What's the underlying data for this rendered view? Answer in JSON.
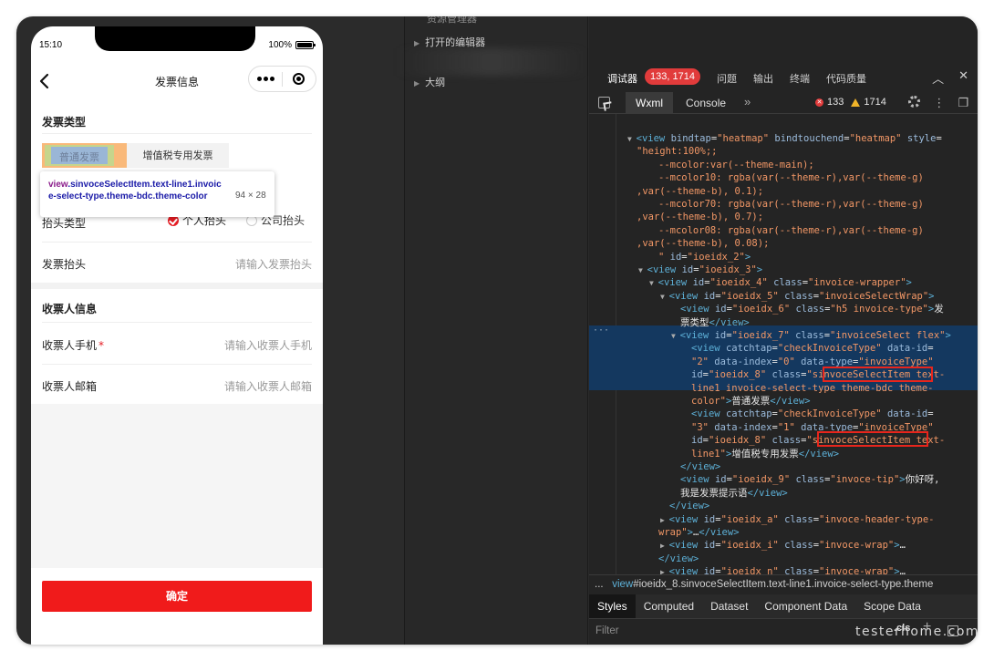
{
  "phone": {
    "status_time": "15:10",
    "battery": "100%",
    "nav_title": "发票信息",
    "section_invoice_type": "发票类型",
    "type_general": "普通发票",
    "type_vat": "增值税专用发票",
    "inspector": {
      "tag": "view",
      "selector_rest": ".sinvoceSelectItem.text-line1.invoice-select-type.theme-bdc.theme-color",
      "size": "94 × 28"
    },
    "title_type_label": "抬头类型",
    "radio_personal": "个人抬头",
    "radio_company": "公司抬头",
    "invoice_title_label": "发票抬头",
    "invoice_title_placeholder": "请输入发票抬头",
    "section_recipient": "收票人信息",
    "recipient_phone_label": "收票人手机",
    "recipient_phone_required": "*",
    "recipient_phone_placeholder": "请输入收票人手机",
    "recipient_email_label": "收票人邮箱",
    "recipient_email_placeholder": "请输入收票人邮箱",
    "confirm": "确定"
  },
  "middle": {
    "top_item": "资源管理器",
    "open_editors": "打开的编辑器",
    "outline": "大纲"
  },
  "devtools": {
    "tab_debugger": "调试器",
    "badge": "133, 1714",
    "tabs_other": [
      "问题",
      "输出",
      "终端",
      "代码质量"
    ],
    "tab_wxml": "Wxml",
    "tab_console": "Console",
    "more": "»",
    "error_count": "133",
    "warn_count": "1714",
    "code_lines": [
      {
        "indent": 0,
        "tri": "▼",
        "parts": [
          [
            "tg",
            "<view "
          ],
          [
            "at",
            "bindtap"
          ],
          [
            "tx",
            "="
          ],
          [
            "av",
            "\"heatmap\""
          ],
          [
            "at",
            " bindtouchend"
          ],
          [
            "tx",
            "="
          ],
          [
            "av",
            "\"heatmap\""
          ],
          [
            "at",
            " style"
          ],
          [
            "tx",
            "="
          ]
        ]
      },
      {
        "indent": 0,
        "parts": [
          [
            "av",
            "\"height:100%;;"
          ]
        ]
      },
      {
        "indent": 2,
        "parts": [
          [
            "av",
            "--mcolor:var(--theme-main);"
          ]
        ]
      },
      {
        "indent": 2,
        "parts": [
          [
            "av",
            "--mcolor10: rgba(var(--theme-r),var(--theme-g)"
          ]
        ]
      },
      {
        "indent": 0,
        "parts": [
          [
            "av",
            ",var(--theme-b), 0.1);"
          ]
        ]
      },
      {
        "indent": 2,
        "parts": [
          [
            "av",
            "--mcolor70: rgba(var(--theme-r),var(--theme-g)"
          ]
        ]
      },
      {
        "indent": 0,
        "parts": [
          [
            "av",
            ",var(--theme-b), 0.7);"
          ]
        ]
      },
      {
        "indent": 2,
        "parts": [
          [
            "av",
            "--mcolor08: rgba(var(--theme-r),var(--theme-g)"
          ]
        ]
      },
      {
        "indent": 0,
        "parts": [
          [
            "av",
            ",var(--theme-b), 0.08);"
          ]
        ]
      },
      {
        "indent": 2,
        "parts": [
          [
            "av",
            "\""
          ],
          [
            "at",
            " id"
          ],
          [
            "tx",
            "="
          ],
          [
            "av",
            "\"ioeidx_2\""
          ],
          [
            "tg",
            ">"
          ]
        ]
      },
      {
        "indent": 1,
        "tri": "▼",
        "parts": [
          [
            "tg",
            "<view "
          ],
          [
            "at",
            "id"
          ],
          [
            "tx",
            "="
          ],
          [
            "av",
            "\"ioeidx_3\""
          ],
          [
            "tg",
            ">"
          ]
        ]
      },
      {
        "indent": 2,
        "tri": "▼",
        "parts": [
          [
            "tg",
            "<view "
          ],
          [
            "at",
            "id"
          ],
          [
            "tx",
            "="
          ],
          [
            "av",
            "\"ioeidx_4\""
          ],
          [
            "at",
            " class"
          ],
          [
            "tx",
            "="
          ],
          [
            "av",
            "\"invoice-wrapper\""
          ],
          [
            "tg",
            ">"
          ]
        ]
      },
      {
        "indent": 3,
        "tri": "▼",
        "parts": [
          [
            "tg",
            "<view "
          ],
          [
            "at",
            "id"
          ],
          [
            "tx",
            "="
          ],
          [
            "av",
            "\"ioeidx_5\""
          ],
          [
            "at",
            " class"
          ],
          [
            "tx",
            "="
          ],
          [
            "av",
            "\"invoiceSelectWrap\""
          ],
          [
            "tg",
            ">"
          ]
        ]
      },
      {
        "indent": 4,
        "parts": [
          [
            "tg",
            "<view "
          ],
          [
            "at",
            "id"
          ],
          [
            "tx",
            "="
          ],
          [
            "av",
            "\"ioeidx_6\""
          ],
          [
            "at",
            " class"
          ],
          [
            "tx",
            "="
          ],
          [
            "av",
            "\"h5 invoice-type\""
          ],
          [
            "tg",
            ">"
          ],
          [
            "tx",
            "发"
          ]
        ]
      },
      {
        "indent": 4,
        "parts": [
          [
            "tx",
            "票类型"
          ],
          [
            "tg",
            "</view>"
          ]
        ]
      },
      {
        "indent": 4,
        "tri": "▼",
        "parts": [
          [
            "tg",
            "<view "
          ],
          [
            "at",
            "id"
          ],
          [
            "tx",
            "="
          ],
          [
            "av",
            "\"ioeidx_7\""
          ],
          [
            "at",
            " class"
          ],
          [
            "tx",
            "="
          ],
          [
            "av",
            "\"invoiceSelect flex\""
          ],
          [
            "tg",
            ">"
          ]
        ]
      },
      {
        "indent": 5,
        "parts": [
          [
            "tg",
            "<view "
          ],
          [
            "at",
            "catchtap"
          ],
          [
            "tx",
            "="
          ],
          [
            "av",
            "\"checkInvoiceType\""
          ],
          [
            "at",
            " data-id"
          ],
          [
            "tx",
            "="
          ]
        ]
      },
      {
        "indent": 5,
        "parts": [
          [
            "av",
            "\"2\""
          ],
          [
            "at",
            " data-index"
          ],
          [
            "tx",
            "="
          ],
          [
            "av",
            "\"0\""
          ],
          [
            "at",
            " data-type"
          ],
          [
            "tx",
            "="
          ],
          [
            "av",
            "\"invoiceType\""
          ]
        ]
      },
      {
        "indent": 5,
        "parts": [
          [
            "at",
            "id"
          ],
          [
            "tx",
            "="
          ],
          [
            "av",
            "\"ioeidx_8\""
          ],
          [
            "at",
            " class"
          ],
          [
            "tx",
            "="
          ],
          [
            "av",
            "\"sinvoceSelectItem text-"
          ]
        ]
      },
      {
        "indent": 5,
        "parts": [
          [
            "av",
            "line1 invoice-select-type theme-bdc theme-"
          ]
        ]
      },
      {
        "indent": 5,
        "parts": [
          [
            "av",
            "color\""
          ],
          [
            "tg",
            ">"
          ],
          [
            "tx",
            "普通发票"
          ],
          [
            "tg",
            "</view>"
          ]
        ]
      },
      {
        "indent": 5,
        "parts": [
          [
            "tg",
            "<view "
          ],
          [
            "at",
            "catchtap"
          ],
          [
            "tx",
            "="
          ],
          [
            "av",
            "\"checkInvoiceType\""
          ],
          [
            "at",
            " data-id"
          ],
          [
            "tx",
            "="
          ]
        ]
      },
      {
        "indent": 5,
        "parts": [
          [
            "av",
            "\"3\""
          ],
          [
            "at",
            " data-index"
          ],
          [
            "tx",
            "="
          ],
          [
            "av",
            "\"1\""
          ],
          [
            "at",
            " data-type"
          ],
          [
            "tx",
            "="
          ],
          [
            "av",
            "\"invoiceType\""
          ]
        ]
      },
      {
        "indent": 5,
        "parts": [
          [
            "at",
            "id"
          ],
          [
            "tx",
            "="
          ],
          [
            "av",
            "\"ioeidx_8\""
          ],
          [
            "at",
            " class"
          ],
          [
            "tx",
            "="
          ],
          [
            "av",
            "\"sinvoceSelectItem text-"
          ]
        ]
      },
      {
        "indent": 5,
        "parts": [
          [
            "av",
            "line1\""
          ],
          [
            "tg",
            ">"
          ],
          [
            "tx",
            "增值税专用发票"
          ],
          [
            "tg",
            "</view>"
          ]
        ]
      },
      {
        "indent": 4,
        "parts": [
          [
            "tg",
            "</view>"
          ]
        ]
      },
      {
        "indent": 4,
        "parts": [
          [
            "tg",
            "<view "
          ],
          [
            "at",
            "id"
          ],
          [
            "tx",
            "="
          ],
          [
            "av",
            "\"ioeidx_9\""
          ],
          [
            "at",
            " class"
          ],
          [
            "tx",
            "="
          ],
          [
            "av",
            "\"invoce-tip\""
          ],
          [
            "tg",
            ">"
          ],
          [
            "tx",
            "你好呀,"
          ]
        ]
      },
      {
        "indent": 4,
        "parts": [
          [
            "tx",
            "我是发票提示语"
          ],
          [
            "tg",
            "</view>"
          ]
        ]
      },
      {
        "indent": 3,
        "parts": [
          [
            "tg",
            "</view>"
          ]
        ]
      },
      {
        "indent": 3,
        "tri": "▶",
        "parts": [
          [
            "tg",
            "<view "
          ],
          [
            "at",
            "id"
          ],
          [
            "tx",
            "="
          ],
          [
            "av",
            "\"ioeidx_a\""
          ],
          [
            "at",
            " class"
          ],
          [
            "tx",
            "="
          ],
          [
            "av",
            "\"invoce-header-type-"
          ]
        ]
      },
      {
        "indent": 2,
        "parts": [
          [
            "av",
            "wrap\""
          ],
          [
            "tg",
            ">"
          ],
          [
            "tx",
            "…"
          ],
          [
            "tg",
            "</view>"
          ]
        ]
      },
      {
        "indent": 3,
        "tri": "▶",
        "parts": [
          [
            "tg",
            "<view "
          ],
          [
            "at",
            "id"
          ],
          [
            "tx",
            "="
          ],
          [
            "av",
            "\"ioeidx_i\""
          ],
          [
            "at",
            " class"
          ],
          [
            "tx",
            "="
          ],
          [
            "av",
            "\"invoce-wrap\""
          ],
          [
            "tg",
            ">"
          ],
          [
            "tx",
            "…"
          ]
        ]
      },
      {
        "indent": 2,
        "parts": [
          [
            "tg",
            "</view>"
          ]
        ]
      },
      {
        "indent": 3,
        "tri": "▶",
        "parts": [
          [
            "tg",
            "<view "
          ],
          [
            "at",
            "id"
          ],
          [
            "tx",
            "="
          ],
          [
            "av",
            "\"ioeidx_n\""
          ],
          [
            "at",
            " class"
          ],
          [
            "tx",
            "="
          ],
          [
            "av",
            "\"invoce-wrap\""
          ],
          [
            "tg",
            ">"
          ],
          [
            "tx",
            "…"
          ]
        ]
      },
      {
        "indent": 2,
        "parts": [
          [
            "tg",
            "</view>"
          ]
        ]
      }
    ],
    "breadcrumb_prefix": "...",
    "breadcrumb_tag": "view",
    "breadcrumb_rest": "#ioeidx_8.sinvoceSelectItem.text-line1.invoice-select-type.theme",
    "subtabs": [
      "Styles",
      "Computed",
      "Dataset",
      "Component Data",
      "Scope Data"
    ],
    "filter_placeholder": "Filter",
    "cls": ".cls",
    "plus": "+"
  },
  "watermark": "testerhome.com"
}
